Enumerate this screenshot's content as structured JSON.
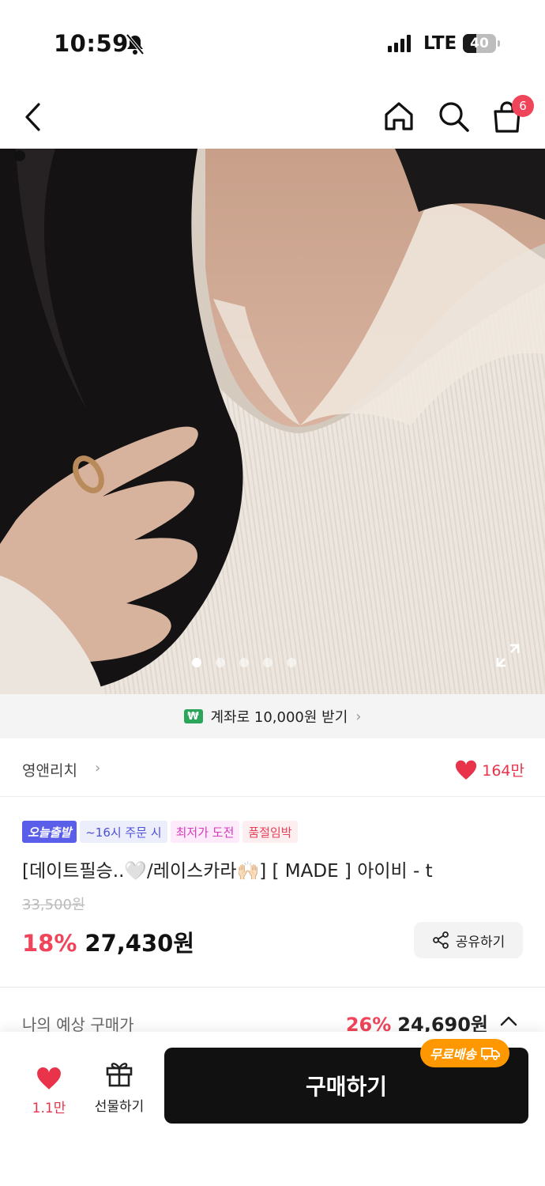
{
  "status_bar": {
    "time": "10:59",
    "network": "LTE",
    "battery": "40",
    "battery_level": 0.4
  },
  "nav": {
    "cart_count": "6"
  },
  "hero": {
    "dot_count": 5,
    "active_dot": 1
  },
  "banner": {
    "text": "계좌로 10,000원 받기",
    "icon": "₩"
  },
  "store": {
    "name": "영앤리치",
    "likes": "164만"
  },
  "product": {
    "tags": [
      "오늘출발",
      "~16시 주문 시",
      "최저가 도전",
      "품절임박"
    ],
    "title": "[데이트필승..🤍/레이스카라🙌🏻] [ MADE ] 아이비 - t",
    "original_price": "33,500원",
    "discount": "18%",
    "price": "27,430원",
    "share_label": "공유하기"
  },
  "expected": {
    "label": "나의 예상 구매가",
    "discount": "26%",
    "price": "24,690원"
  },
  "bottom_bar": {
    "like_count": "1.1만",
    "gift_label": "선물하기",
    "buy_label": "구매하기",
    "free_shipping": "무료배송"
  },
  "colors": {
    "accent": "#f0445a",
    "buy_button": "#111111",
    "free_shipping": "#ff9800"
  }
}
